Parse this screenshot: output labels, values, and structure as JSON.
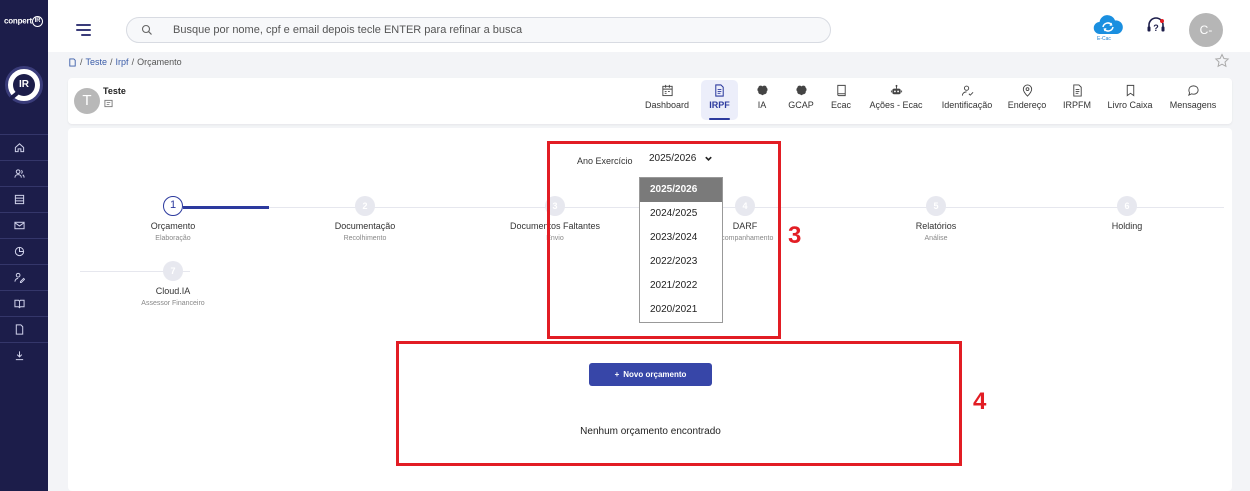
{
  "sidebar": {
    "brand": "conpert",
    "logo_text": "IR",
    "items": [
      {
        "icon": "home-icon"
      },
      {
        "icon": "users-icon"
      },
      {
        "icon": "list-icon"
      },
      {
        "icon": "mail-icon"
      },
      {
        "icon": "pie-chart-icon"
      },
      {
        "icon": "user-edit-icon"
      },
      {
        "icon": "book-icon"
      },
      {
        "icon": "document-icon"
      },
      {
        "icon": "download-icon"
      }
    ]
  },
  "topbar": {
    "search_placeholder": "Busque por nome, cpf e email depois tecle ENTER para refinar a busca",
    "ecac_label": "E-Cac",
    "user_avatar": "C-"
  },
  "breadcrumb": [
    "Teste",
    "Irpf",
    "Orçamento"
  ],
  "client": {
    "initial": "T",
    "name": "Teste"
  },
  "nav_tabs": [
    {
      "label": "Dashboard",
      "icon": "calendar-icon",
      "active": false
    },
    {
      "label": "IRPF",
      "icon": "document-icon",
      "active": true
    },
    {
      "label": "IA",
      "icon": "brain-icon",
      "active": false
    },
    {
      "label": "GCAP",
      "icon": "brain-icon",
      "active": false
    },
    {
      "label": "Ecac",
      "icon": "book-icon",
      "active": false
    },
    {
      "label": "Ações - Ecac",
      "icon": "robot-icon",
      "active": false
    },
    {
      "label": "Identificação",
      "icon": "user-check-icon",
      "active": false
    },
    {
      "label": "Endereço",
      "icon": "location-pin-icon",
      "active": false
    },
    {
      "label": "IRPFM",
      "icon": "document-icon",
      "active": false
    },
    {
      "label": "Livro Caixa",
      "icon": "bookmark-icon",
      "active": false
    },
    {
      "label": "Mensagens",
      "icon": "chat-bubble-icon",
      "active": false
    }
  ],
  "year": {
    "label": "Ano Exercício",
    "selected": "2025/2026",
    "options": [
      "2025/2026",
      "2024/2025",
      "2023/2024",
      "2022/2023",
      "2021/2022",
      "2020/2021"
    ]
  },
  "steps": [
    {
      "num": "1",
      "title": "Orçamento",
      "sub": "Elaboração"
    },
    {
      "num": "2",
      "title": "Documentação",
      "sub": "Recolhimento"
    },
    {
      "num": "3",
      "title": "Documentos Faltantes",
      "sub": "Envio"
    },
    {
      "num": "4",
      "title": "DARF",
      "sub": "Acompanhamento"
    },
    {
      "num": "5",
      "title": "Relatórios",
      "sub": "Análise"
    },
    {
      "num": "6",
      "title": "Holding",
      "sub": ""
    },
    {
      "num": "7",
      "title": "Cloud.IA",
      "sub": "Assessor Financeiro"
    }
  ],
  "actions": {
    "new_button": "Novo orçamento",
    "empty_message": "Nenhum orçamento encontrado"
  },
  "annotations": {
    "box3": "3",
    "box4": "4"
  },
  "colors": {
    "sidebar": "#1c1d4a",
    "accent": "#2c3a9e",
    "button": "#3746a8",
    "annotation": "#e21d24"
  }
}
